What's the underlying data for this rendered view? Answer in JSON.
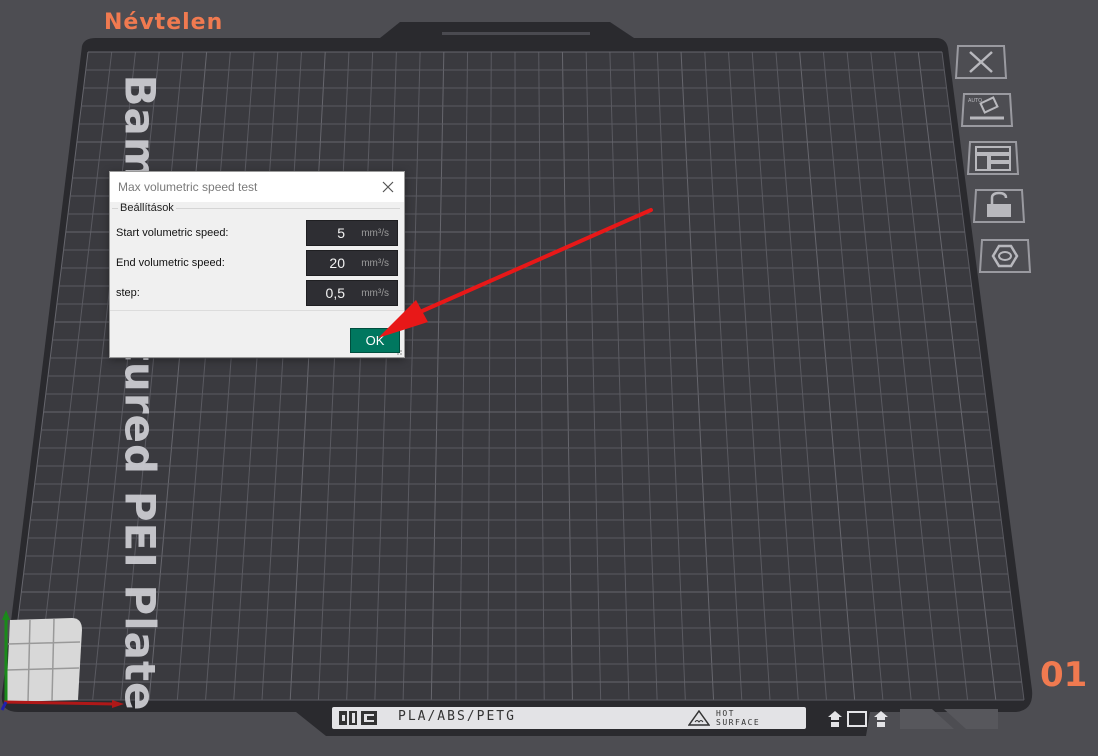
{
  "plate": {
    "name": "Névtelen",
    "brand_text": "Bambu Textured PEI Plate",
    "index": "01",
    "materials": "PLA/ABS/PETG",
    "hot_line1": "HOT",
    "hot_line2": "SURFACE"
  },
  "dialog": {
    "title": "Max volumetric speed test",
    "group_label": "Beállítások",
    "fields": [
      {
        "label": "Start volumetric speed:",
        "value": "5",
        "unit": "mm³/s"
      },
      {
        "label": "End volumetric speed:",
        "value": "20",
        "unit": "mm³/s"
      },
      {
        "label": "step:",
        "value": "0,5",
        "unit": "mm³/s"
      }
    ],
    "ok_label": "OK"
  },
  "side_toolbar": [
    "close-icon",
    "auto-orient-icon",
    "arrange-icon",
    "lock-icon",
    "plate-settings-icon"
  ],
  "colors": {
    "background": "#4d4d52",
    "plate": "#35353a",
    "grid": "#5a5a60",
    "accent": "#f07a50",
    "ok_button": "#00775f",
    "annotation_arrow": "#e81818"
  }
}
